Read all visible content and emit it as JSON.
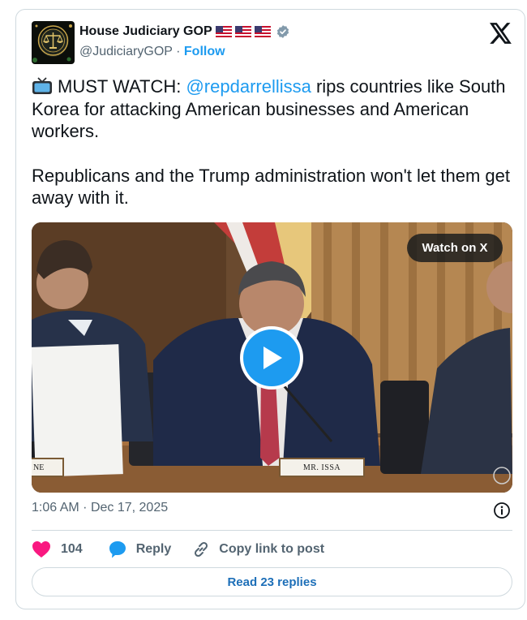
{
  "author": {
    "display_name": "House Judiciary GOP",
    "handle": "@JudiciaryGOP",
    "separator": "·",
    "follow_label": "Follow",
    "flags": [
      "us-flag-icon",
      "us-flag-icon",
      "us-flag-icon"
    ],
    "verified": "verified-badge-icon"
  },
  "tweet": {
    "emoji": "tv-icon",
    "line1_prefix": "MUST WATCH: ",
    "mention": "@repdarrellissa",
    "line1_suffix": " rips countries like South Korea for attacking American businesses and American workers.",
    "paragraph2": "Republicans and the Trump administration won't let them get away with it."
  },
  "media": {
    "watch_label": "Watch on X",
    "nameplate_center": "MR. ISSA",
    "nameplate_left": "NE",
    "play_icon": "play-icon"
  },
  "meta": {
    "time": "1:06 AM",
    "separator": "·",
    "date": "Dec 17, 2025"
  },
  "actions": {
    "like_count": "104",
    "reply_label": "Reply",
    "copy_label": "Copy link to post"
  },
  "read_replies_label": "Read 23 replies",
  "colors": {
    "accent": "#1d9bf0",
    "like": "#f91880",
    "text": "#0f1419",
    "muted": "#536471",
    "border": "#cfd9de"
  }
}
